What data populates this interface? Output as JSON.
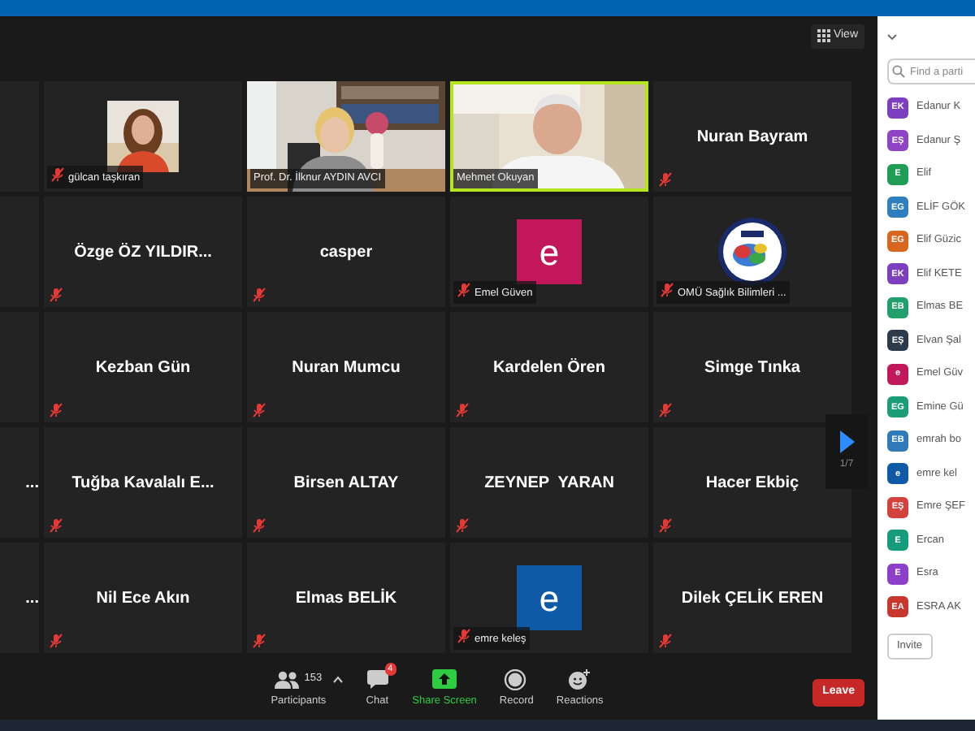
{
  "view_button": {
    "label": "View"
  },
  "grid_rows": [
    {
      "tiles": [
        {
          "kind": "partial"
        },
        {
          "label": "gülcan taşkıran",
          "muted": true,
          "speaking": false
        },
        {
          "kind": "video",
          "label": "Prof. Dr. İlknur AYDIN AVCI",
          "muted": false,
          "speaking": false
        },
        {
          "kind": "video",
          "label": "Mehmet Okuyan",
          "muted": false,
          "speaking": true
        },
        {
          "kind": "name",
          "name": "Nuran Bayram",
          "muted": true,
          "speaking": false
        }
      ]
    },
    {
      "tiles": [
        {
          "kind": "partial"
        },
        {
          "kind": "name",
          "name": "Özge ÖZ YILDIR...",
          "muted": true,
          "speaking": false
        },
        {
          "kind": "name",
          "name": "casper",
          "muted": true,
          "speaking": false
        },
        {
          "kind": "letter",
          "letter": "e",
          "color": "#c2185b",
          "label": "Emel Güven",
          "muted": true,
          "speaking": false
        },
        {
          "kind": "logo",
          "label": "OMÜ Sağlık Bilimleri ...",
          "muted": true,
          "speaking": false
        }
      ]
    },
    {
      "tiles": [
        {
          "kind": "partial"
        },
        {
          "kind": "name",
          "name": "Kezban Gün",
          "muted": true,
          "speaking": false
        },
        {
          "kind": "name",
          "name": "Nuran Mumcu",
          "muted": true,
          "speaking": false
        },
        {
          "kind": "name",
          "name": "Kardelen Ören",
          "muted": true,
          "speaking": false
        },
        {
          "kind": "name",
          "name": "Simge Tınka",
          "muted": true,
          "speaking": false
        }
      ]
    },
    {
      "tiles": [
        {
          "kind": "partial",
          "name": "..."
        },
        {
          "kind": "name",
          "name": "Tuğba Kavalalı E...",
          "muted": true,
          "speaking": false
        },
        {
          "kind": "name",
          "name": "Birsen ALTAY",
          "muted": true,
          "speaking": false
        },
        {
          "kind": "name",
          "name": "ZEYNEP  YARAN",
          "muted": true,
          "speaking": false
        },
        {
          "kind": "name",
          "name": "Hacer Ekbiç",
          "muted": true,
          "speaking": false
        }
      ]
    },
    {
      "tiles": [
        {
          "kind": "partial",
          "name": "..."
        },
        {
          "kind": "name",
          "name": "Nil Ece Akın",
          "muted": true,
          "speaking": false
        },
        {
          "kind": "name",
          "name": "Elmas BELİK",
          "muted": true,
          "speaking": false
        },
        {
          "kind": "letter",
          "letter": "e",
          "color": "#0e5aa7",
          "label": "emre keleş",
          "muted": true,
          "speaking": false
        },
        {
          "kind": "name",
          "name": "Dilek ÇELİK EREN",
          "muted": true,
          "speaking": false
        }
      ]
    }
  ],
  "pager": {
    "label": "1/7"
  },
  "toolbar": {
    "items": [
      {
        "kind": "participants",
        "label": "Participants",
        "count": "153"
      },
      {
        "kind": "chat",
        "label": "Chat",
        "badge": "4"
      },
      {
        "kind": "share",
        "label": "Share Screen"
      },
      {
        "kind": "record",
        "label": "Record"
      },
      {
        "kind": "reactions",
        "label": "Reactions"
      }
    ],
    "leave_button": "Leave"
  },
  "panel": {
    "search": {
      "placeholder": "Find a parti"
    },
    "participants": [
      {
        "initials": "EK",
        "name": "Edanur K",
        "color": "#7b3fbf"
      },
      {
        "initials": "EŞ",
        "name": "Edanur Ş",
        "color": "#8e44c4"
      },
      {
        "initials": "E",
        "name": "Elif",
        "color": "#1f9d55"
      },
      {
        "initials": "EG",
        "name": "ELİF GÖK",
        "color": "#2f7fbf"
      },
      {
        "initials": "EG",
        "name": "Elif Güzic",
        "color": "#d9661f"
      },
      {
        "initials": "EK",
        "name": "Elif KETE",
        "color": "#7b3fbf"
      },
      {
        "initials": "EB",
        "name": "Elmas BE",
        "color": "#22a06b"
      },
      {
        "initials": "EŞ",
        "name": "Elvan Şal",
        "color": "#2d3a4a"
      },
      {
        "initials": "e",
        "name": "Emel Güv",
        "color": "#c2185b"
      },
      {
        "initials": "EG",
        "name": "Emine Gü",
        "color": "#1b9e77"
      },
      {
        "initials": "EB",
        "name": "emrah bo",
        "color": "#2f7ab8"
      },
      {
        "initials": "e",
        "name": "emre kel",
        "color": "#0e5aa7"
      },
      {
        "initials": "EŞ",
        "name": "Emre ŞEF",
        "color": "#d2423b"
      },
      {
        "initials": "E",
        "name": "Ercan",
        "color": "#169c7c"
      },
      {
        "initials": "E",
        "name": "Esra",
        "color": "#8c3fc9"
      },
      {
        "initials": "EA",
        "name": "ESRA AK",
        "color": "#c8372d"
      }
    ],
    "invite_button": "Invite"
  }
}
